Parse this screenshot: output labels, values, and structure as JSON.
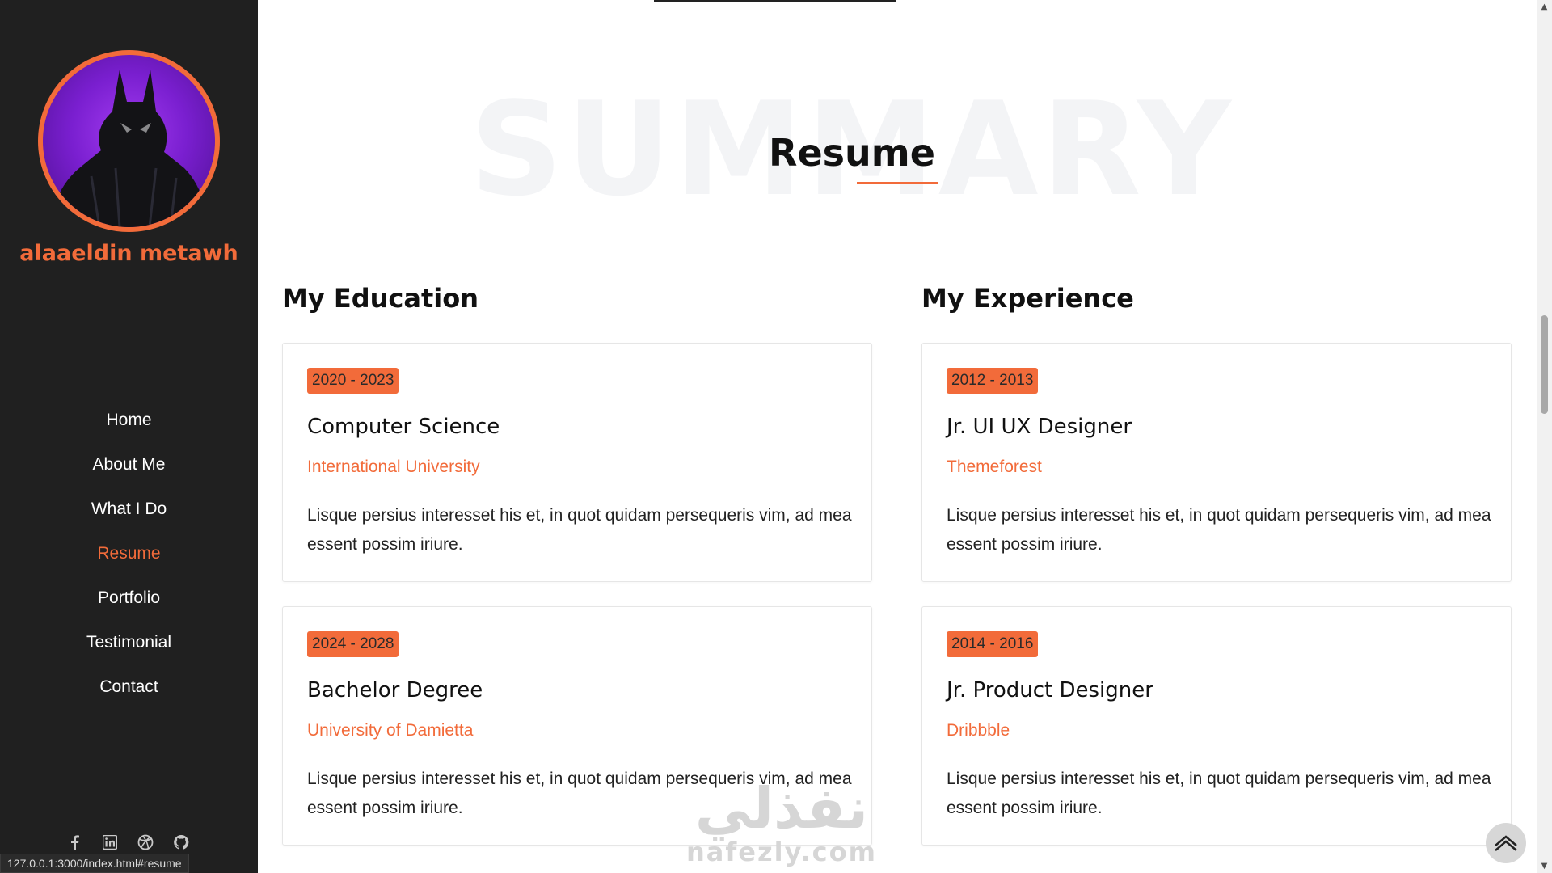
{
  "profile": {
    "name": "alaaeldin metawh"
  },
  "nav": {
    "items": [
      {
        "label": "Home"
      },
      {
        "label": "About Me"
      },
      {
        "label": "What I Do"
      },
      {
        "label": "Resume"
      },
      {
        "label": "Portfolio"
      },
      {
        "label": "Testimonial"
      },
      {
        "label": "Contact"
      }
    ],
    "active": "Resume"
  },
  "social": [
    "facebook-icon",
    "linkedin-icon",
    "dribbble-icon",
    "github-icon"
  ],
  "status_bar": {
    "url": "127.0.0.1:3000/index.html#resume"
  },
  "section": {
    "background_word": "SUMMARY",
    "title": "Resume"
  },
  "education": {
    "heading": "My Education",
    "items": [
      {
        "years": "2020 - 2023",
        "title": "Computer Science",
        "org": "International University",
        "desc": "Lisque persius interesset his et, in quot quidam persequeris vim, ad mea essent possim iriure."
      },
      {
        "years": "2024 - 2028",
        "title": "Bachelor Degree",
        "org": "University of Damietta",
        "desc": "Lisque persius interesset his et, in quot quidam persequeris vim, ad mea essent possim iriure."
      }
    ]
  },
  "experience": {
    "heading": "My Experience",
    "items": [
      {
        "years": "2012 - 2013",
        "title": "Jr. UI UX Designer",
        "org": "Themeforest",
        "desc": "Lisque persius interesset his et, in quot quidam persequeris vim, ad mea essent possim iriure."
      },
      {
        "years": "2014 - 2016",
        "title": "Jr. Product Designer",
        "org": "Dribbble",
        "desc": "Lisque persius interesset his et, in quot quidam persequeris vim, ad mea essent possim iriure."
      }
    ]
  },
  "watermark": {
    "arabic": "نفذلي",
    "latin": "nafezly.com"
  },
  "colors": {
    "accent": "#f26b3a",
    "sidebar_bg": "#202020"
  }
}
